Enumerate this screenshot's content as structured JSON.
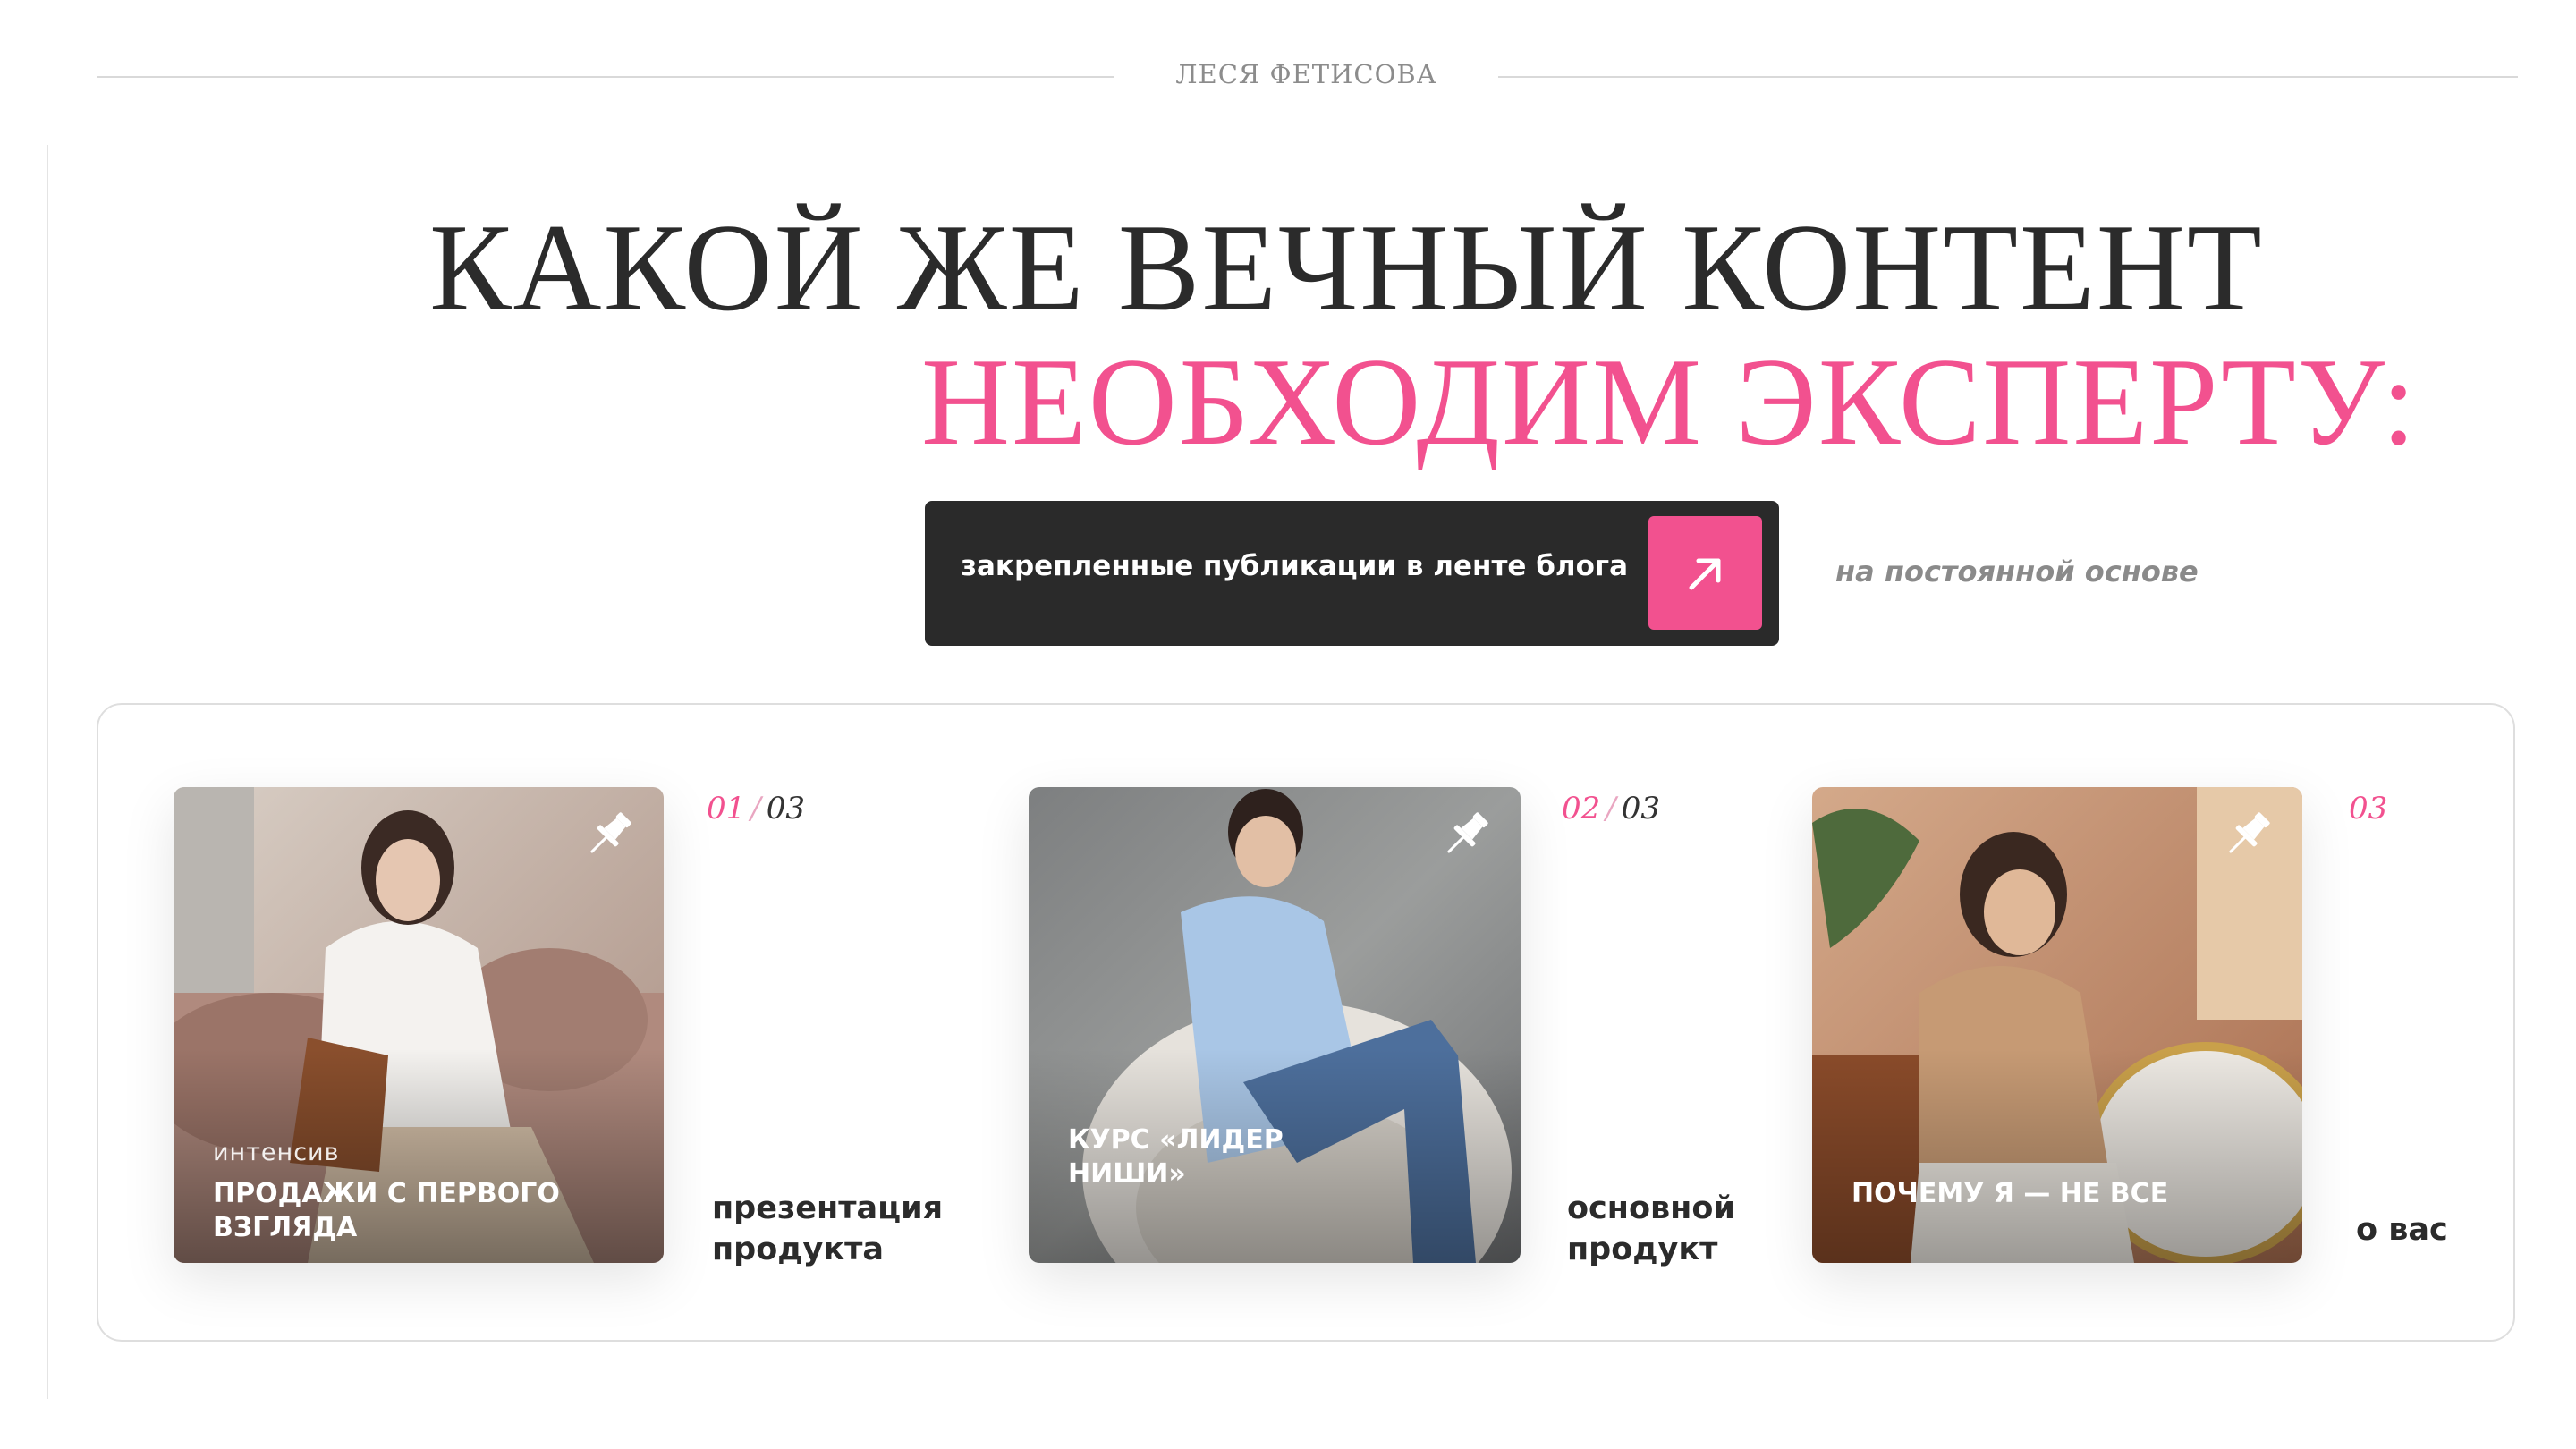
{
  "header": {
    "brand": "ЛЕСЯ ФЕТИСОВА"
  },
  "headline": {
    "line1": "КАКОЙ ЖЕ ВЕЧНЫЙ КОНТЕНТ",
    "line2": "НЕОБХОДИМ ЭКСПЕРТУ:"
  },
  "pill": {
    "text": "закрепленные публикации в ленте блога",
    "icon": "arrow-up-right-icon"
  },
  "side_note": "на постоянной основе",
  "colors": {
    "accent": "#f2518f",
    "dark": "#2a2a2a",
    "text": "#2b2b2b",
    "muted": "#8a8a8a"
  },
  "cards": [
    {
      "overlay_small": "интенсив",
      "overlay_big": "ПРОДАЖИ С ПЕРВОГО ВЗГЛЯДА",
      "counter_current": "01",
      "counter_sep": "/",
      "counter_total": "03",
      "label": "презентация продукта",
      "icon": "pin-icon"
    },
    {
      "overlay_small": "",
      "overlay_big": "КУРС «ЛИДЕР НИШИ»",
      "counter_current": "02",
      "counter_sep": "/",
      "counter_total": "03",
      "label": "основной продукт",
      "icon": "pin-icon"
    },
    {
      "overlay_small": "",
      "overlay_big": "ПОЧЕМУ Я — НЕ ВСЕ",
      "counter_current": "03",
      "counter_sep": "",
      "counter_total": "",
      "label": "о вас",
      "icon": "pin-icon"
    }
  ]
}
